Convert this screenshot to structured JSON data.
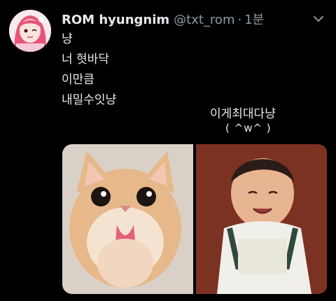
{
  "author": {
    "display_name": "ROM hyungnim",
    "handle": "@txt_rom",
    "separator": "·",
    "time": "1분"
  },
  "tweet": {
    "lines": [
      "냥",
      "너 혓바닥",
      "이만큼",
      "내밀수잇냥"
    ],
    "caption": "이게최대다냥",
    "face": "( ^w^ )"
  },
  "media": [
    {
      "subject": "cat-sticking-out-tongue"
    },
    {
      "subject": "baby-smiling"
    }
  ],
  "icons": {
    "caret": "chevron-down-icon"
  },
  "colors": {
    "background": "#000000",
    "text": "#e7e9ea",
    "secondary": "#8b98a5"
  }
}
